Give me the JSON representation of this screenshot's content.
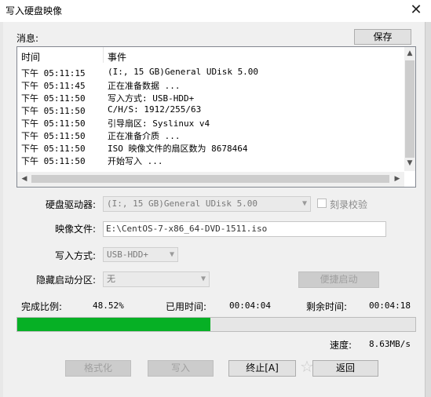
{
  "window": {
    "title": "写入硬盘映像",
    "close_glyph": "✕"
  },
  "messages": {
    "label": "消息:",
    "save_button": "保存",
    "columns": [
      "时间",
      "事件"
    ],
    "rows": [
      {
        "time": "下午 05:11:15",
        "event": "(I:, 15 GB)General UDisk          5.00"
      },
      {
        "time": "下午 05:11:45",
        "event": "正在准备数据 ..."
      },
      {
        "time": "下午 05:11:50",
        "event": "写入方式: USB-HDD+"
      },
      {
        "time": "下午 05:11:50",
        "event": "C/H/S: 1912/255/63"
      },
      {
        "time": "下午 05:11:50",
        "event": "引导扇区: Syslinux v4"
      },
      {
        "time": "下午 05:11:50",
        "event": "正在准备介质 ..."
      },
      {
        "time": "下午 05:11:50",
        "event": "ISO 映像文件的扇区数为 8678464"
      },
      {
        "time": "下午 05:11:50",
        "event": "开始写入 ..."
      }
    ]
  },
  "form": {
    "drive_label": "硬盘驱动器:",
    "drive_value": "(I:, 15 GB)General UDisk          5.00",
    "verify_label": "刻录校验",
    "image_label": "映像文件:",
    "image_value": "E:\\CentOS-7-x86_64-DVD-1511.iso",
    "write_mode_label": "写入方式:",
    "write_mode_value": "USB-HDD+",
    "hidden_part_label": "隐藏启动分区:",
    "hidden_part_value": "无",
    "quick_boot_button": "便捷启动"
  },
  "status": {
    "completed_label": "完成比例:",
    "completed_value": "48.52%",
    "progress_fraction": 0.4852,
    "elapsed_label": "已用时间:",
    "elapsed_value": "00:04:04",
    "remaining_label": "剩余时间:",
    "remaining_value": "00:04:18",
    "speed_label": "速度:",
    "speed_value": "8.63MB/s"
  },
  "buttons": {
    "format": "格式化",
    "write": "写入",
    "abort": "终止[A]",
    "back": "返回"
  },
  "colors": {
    "progress": "#06b025"
  }
}
